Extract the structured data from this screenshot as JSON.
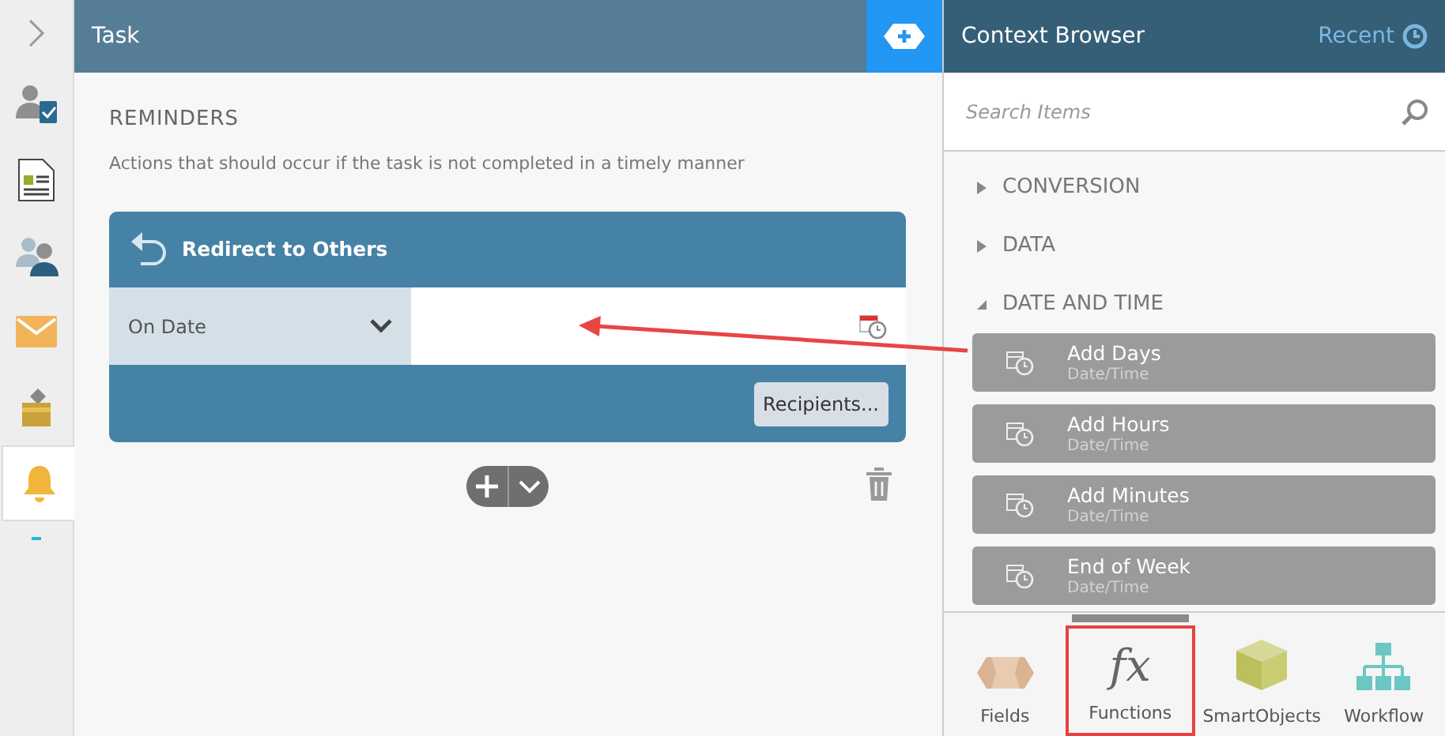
{
  "sidebar": {
    "items": [
      {
        "kind": "expand",
        "selected": false
      },
      {
        "kind": "task-user",
        "selected": false
      },
      {
        "kind": "form",
        "selected": false
      },
      {
        "kind": "users",
        "selected": false
      },
      {
        "kind": "email",
        "selected": false
      },
      {
        "kind": "inbox",
        "selected": false
      },
      {
        "kind": "bell",
        "selected": true
      }
    ]
  },
  "task_panel": {
    "title": "Task",
    "section_title": "REMINDERS",
    "description": "Actions that should occur if the task is not completed in a timely manner",
    "reminder": {
      "title": "Redirect to Others",
      "schedule": "On Date",
      "button": "Recipients..."
    }
  },
  "context_browser": {
    "title": "Context Browser",
    "recent": "Recent",
    "search": {
      "placeholder": "Search Items"
    },
    "categories": [
      {
        "label": "CONVERSION",
        "expanded": false
      },
      {
        "label": "DATA",
        "expanded": false
      },
      {
        "label": "DATE AND TIME",
        "expanded": true,
        "children": [
          {
            "name": "Add Days",
            "type": "Date/Time"
          },
          {
            "name": "Add Hours",
            "type": "Date/Time"
          },
          {
            "name": "Add Minutes",
            "type": "Date/Time"
          },
          {
            "name": "End of Week",
            "type": "Date/Time"
          }
        ]
      }
    ],
    "tabs": [
      {
        "kind": "fields",
        "label": "Fields",
        "selected": false
      },
      {
        "kind": "functions",
        "label": "Functions",
        "icon_text": "fx",
        "selected": true
      },
      {
        "kind": "smartobjects",
        "label": "SmartObjects",
        "selected": false
      },
      {
        "kind": "workflow",
        "label": "Workflow",
        "selected": false
      }
    ]
  }
}
